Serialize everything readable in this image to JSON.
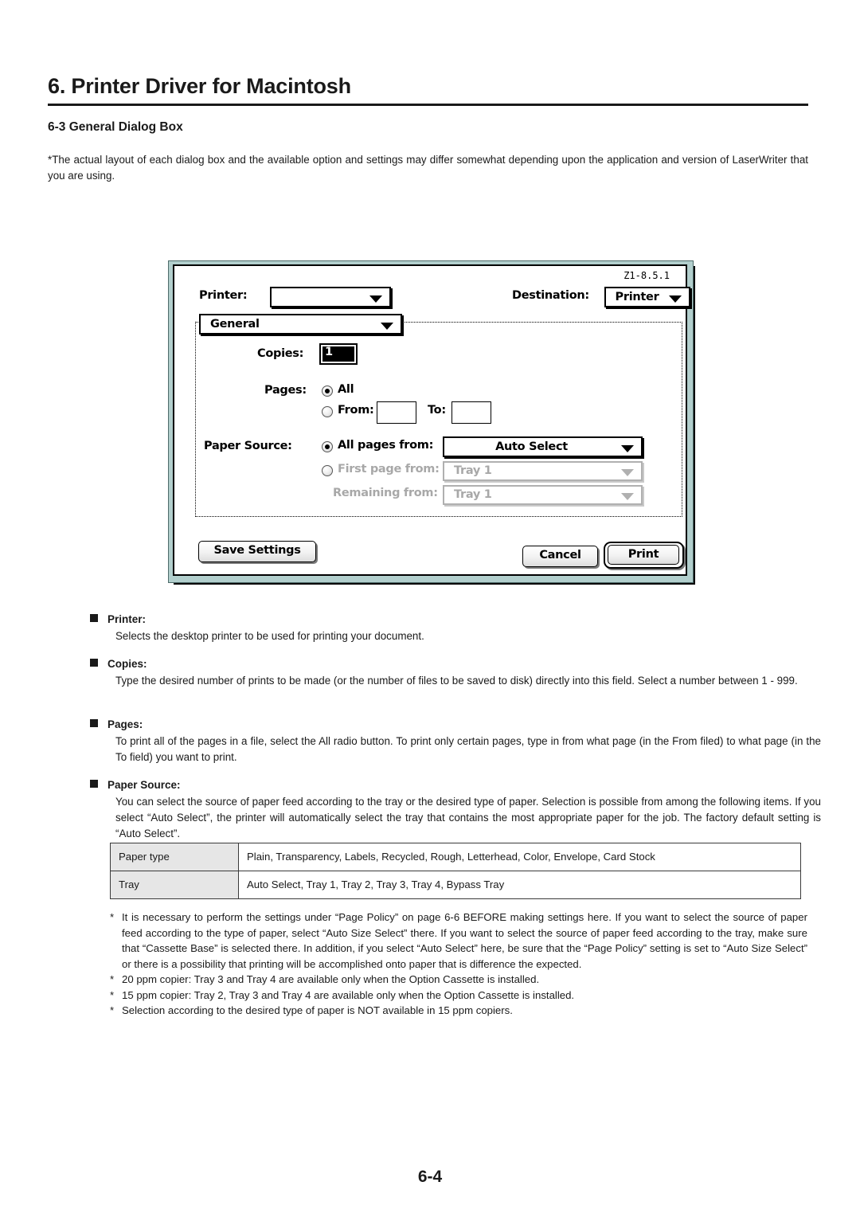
{
  "header": {
    "chapter_title": "6. Printer Driver for Macintosh",
    "section_title": "6-3 General Dialog Box",
    "intro": "*The actual layout of each dialog box and the available option and settings may differ somewhat depending upon the application and version of LaserWriter that you are using."
  },
  "dialog": {
    "version": "Z1-8.5.1",
    "printer_label": "Printer:",
    "printer_value": "",
    "destination_label": "Destination:",
    "destination_value": "Printer",
    "pane_value": "General",
    "copies_label": "Copies:",
    "copies_value": "1",
    "pages_label": "Pages:",
    "pages_all_label": "All",
    "pages_from_label": "From:",
    "pages_from_value": "",
    "pages_to_label": "To:",
    "pages_to_value": "",
    "paper_source_label": "Paper Source:",
    "all_pages_from_label": "All pages from:",
    "all_pages_from_value": "Auto Select",
    "first_page_from_label": "First page from:",
    "first_page_from_value": "Tray 1",
    "remaining_from_label": "Remaining from:",
    "remaining_from_value": "Tray 1",
    "save_settings_label": "Save Settings",
    "cancel_label": "Cancel",
    "print_label": "Print"
  },
  "descriptions": [
    {
      "heading": "Printer:",
      "body": "Selects the desktop printer to be used for printing your document."
    },
    {
      "heading": "Copies:",
      "body": "Type the desired number of prints to be made (or the number of files to be saved to disk) directly into this field. Select a number between 1 - 999."
    },
    {
      "heading": "Pages:",
      "body": "To print all of the pages in a file, select the All radio button. To print only certain pages, type in from what page (in the From filed) to what page (in the To field) you want to print."
    },
    {
      "heading": "Paper Source:",
      "body": "You can select the source of paper feed according to the tray or the desired type of paper. Selection is possible from among the following items. If you select “Auto Select”, the printer will automatically select the tray that contains the most appropriate paper for the job. The factory default setting is “Auto Select”."
    }
  ],
  "table": {
    "rows": [
      {
        "key": "Paper type",
        "value": "Plain, Transparency, Labels, Recycled, Rough, Letterhead, Color, Envelope, Card Stock"
      },
      {
        "key": "Tray",
        "value": "Auto Select, Tray 1, Tray 2, Tray 3, Tray 4, Bypass Tray"
      }
    ]
  },
  "footnotes": {
    "marker": "*",
    "items": [
      "It is necessary to perform the settings under “Page Policy” on page 6-6 BEFORE making settings here. If you want to select the source of paper feed according to the type of paper, select “Auto Size Select” there. If you want to select the source of paper feed according to the tray, make sure that “Cassette Base” is selected there. In addition, if you select “Auto Select” here, be sure that the “Page Policy” setting is set to “Auto Size Select” or there is a possibility that printing will be accomplished onto paper that is difference the expected.",
      "20 ppm copier: Tray 3 and Tray 4 are available only when the Option Cassette is installed.",
      "15 ppm copier: Tray 2, Tray 3 and Tray 4 are available only when the Option Cassette is installed.",
      "Selection according to the desired type of paper is NOT available in 15 ppm copiers."
    ]
  },
  "footer": {
    "page_number": "6-4"
  }
}
